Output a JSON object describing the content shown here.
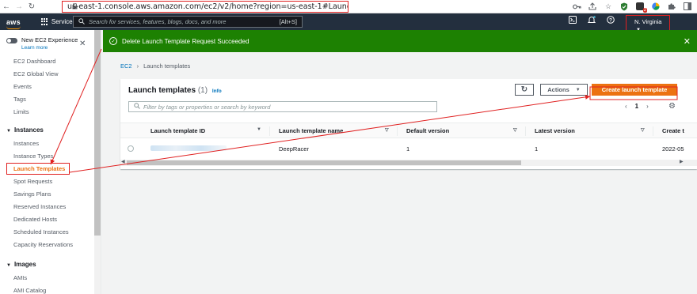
{
  "browser": {
    "url": "us-east-1.console.aws.amazon.com/ec2/v2/home?region=us-east-1#LaunchTemplates:",
    "back_glyph": "←",
    "forward_glyph": "→",
    "reload_glyph": "↻",
    "ext_badge": "2"
  },
  "aws_nav": {
    "logo": "aws",
    "services_label": "Services",
    "search_placeholder": "Search for services, features, blogs, docs, and more",
    "search_shortcut": "[Alt+S]",
    "region_label": "N. Virginia"
  },
  "flash": {
    "message": "Delete Launch Template Request Succeeded",
    "color": "#1d8102"
  },
  "sidebar": {
    "experience_label": "New EC2 Experience",
    "learn_more": "Learn more",
    "top_items": [
      "EC2 Dashboard",
      "EC2 Global View",
      "Events",
      "Tags",
      "Limits"
    ],
    "instances_heading": "Instances",
    "instances_items": [
      "Instances",
      "Instance Types",
      "Launch Templates",
      "Spot Requests",
      "Savings Plans",
      "Reserved Instances",
      "Dedicated Hosts",
      "Scheduled Instances",
      "Capacity Reservations"
    ],
    "images_heading": "Images",
    "images_items": [
      "AMIs",
      "AMI Catalog"
    ]
  },
  "breadcrumb": {
    "root": "EC2",
    "current": "Launch templates"
  },
  "panel": {
    "title": "Launch templates",
    "count": "(1)",
    "info": "Info",
    "actions_label": "Actions",
    "create_label": "Create launch template",
    "filter_placeholder": "Filter by tags or properties or search by keyword",
    "page": "1",
    "columns": [
      "Launch template ID",
      "Launch template name",
      "Default version",
      "Latest version",
      "Create t"
    ],
    "rows": [
      {
        "id": "",
        "name": "DeepRacer",
        "default_version": "1",
        "latest_version": "1",
        "created": "2022-05"
      }
    ]
  },
  "colors": {
    "accent": "#ec7211",
    "link": "#0073bb",
    "nav_bg": "#232f3e",
    "annotation": "#e02020"
  }
}
